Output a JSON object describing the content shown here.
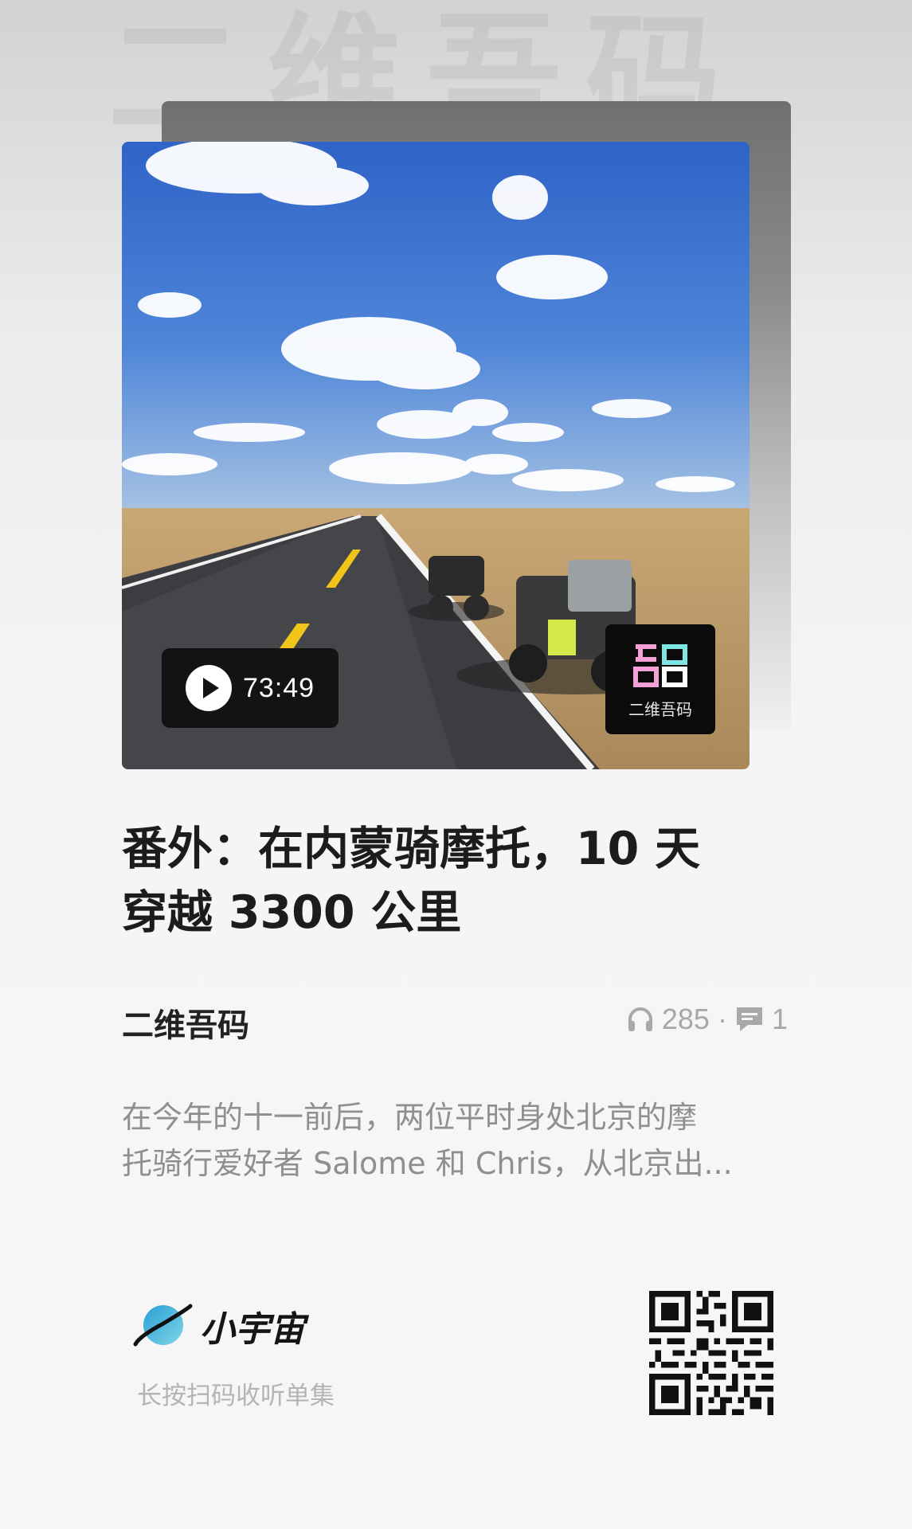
{
  "watermark": "二维吾码",
  "cover": {
    "duration": "73:49",
    "badge_text": "二维吾码"
  },
  "episode": {
    "title_line1": "番外：在内蒙骑摩托，10 天",
    "title_line2": "穿越 3300 公里"
  },
  "podcast": {
    "name": "二维吾码",
    "plays": "285",
    "separator": "·",
    "comments": "1"
  },
  "description": {
    "line1": "在今年的十一前后，两位平时身处北京的摩",
    "line2": "托骑行爱好者 Salome 和 Chris，从北京出..."
  },
  "footer": {
    "brand": "小宇宙",
    "scan_hint": "长按扫码收听单集"
  },
  "icons": {
    "play": "play-icon",
    "headphones": "headphones-icon",
    "comment": "comment-icon",
    "planet": "planet-logo-icon",
    "qr": "qr-code"
  },
  "colors": {
    "title": "#1c1c1c",
    "muted": "#8f8f8f",
    "pill": "#131313",
    "planet": "#3fb7d9"
  }
}
